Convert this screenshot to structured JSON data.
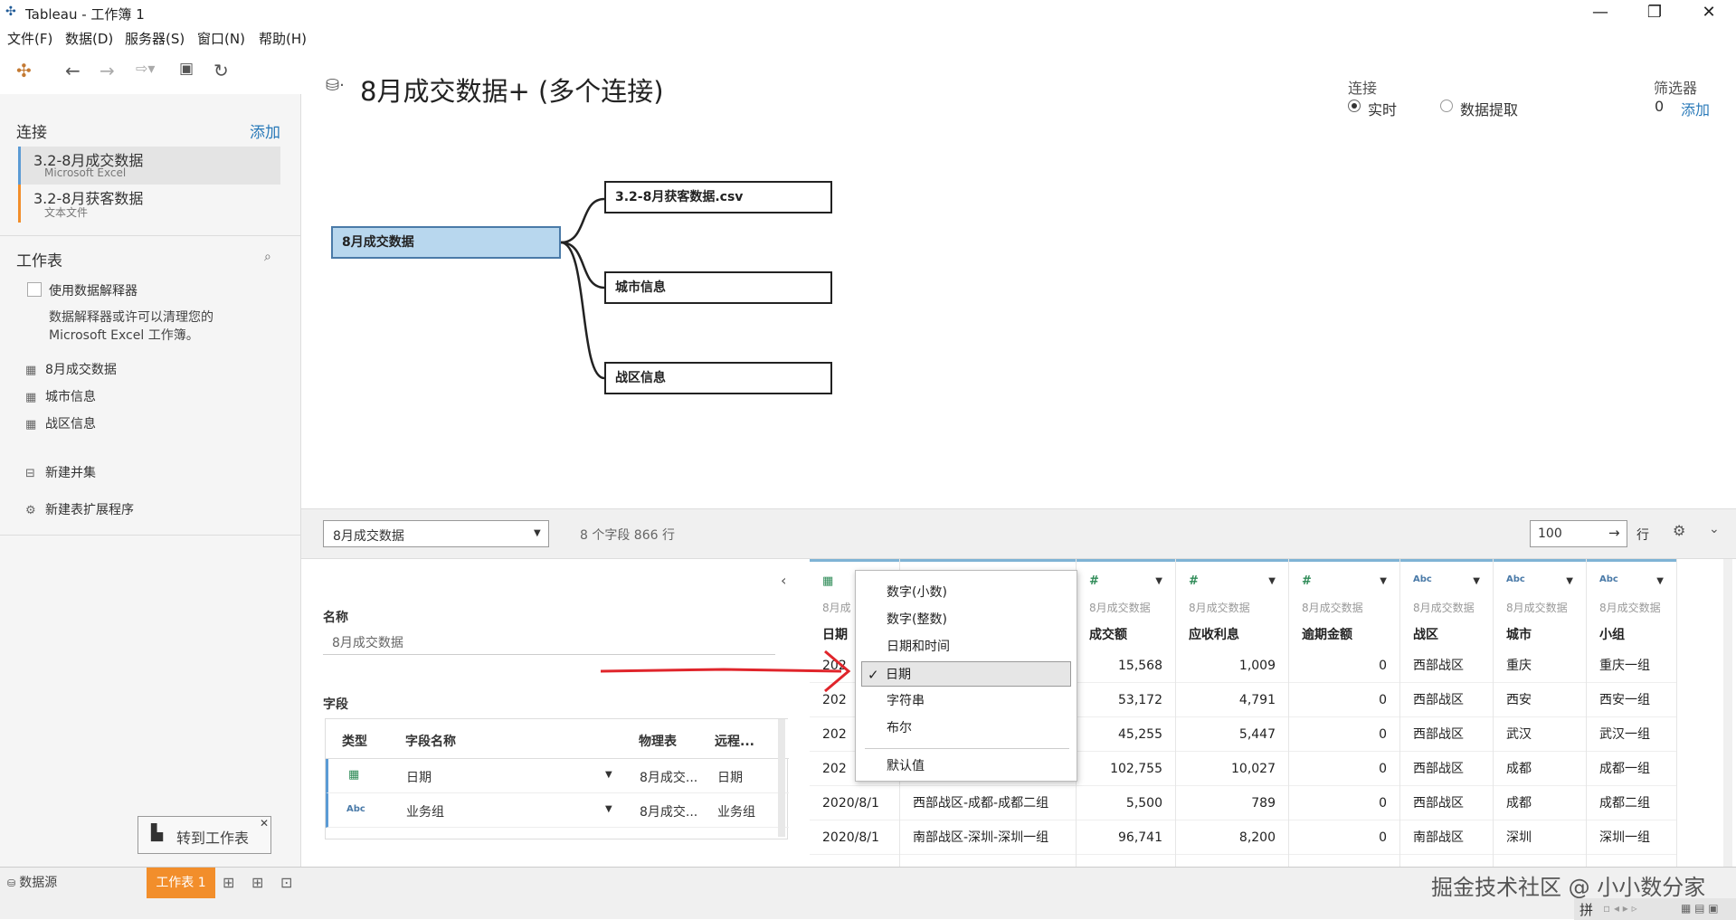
{
  "window": {
    "title": "Tableau - 工作簿 1"
  },
  "menu": [
    "文件(F)",
    "数据(D)",
    "服务器(S)",
    "窗口(N)",
    "帮助(H)"
  ],
  "left": {
    "connections_label": "连接",
    "add_label": "添加",
    "connections": [
      {
        "name": "3.2-8月成交数据",
        "type": "Microsoft Excel"
      },
      {
        "name": "3.2-8月获客数据",
        "type": "文本文件"
      }
    ],
    "sheets_label": "工作表",
    "interpreter_label": "使用数据解释器",
    "interpreter_desc_1": "数据解释器或许可以清理您的",
    "interpreter_desc_2": "Microsoft Excel 工作簿。",
    "sheets": [
      "8月成交数据",
      "城市信息",
      "战区信息"
    ],
    "new_union": "新建并集",
    "new_extension": "新建表扩展程序"
  },
  "canvas": {
    "title": "8月成交数据+ (多个连接)",
    "connection_label": "连接",
    "live_label": "实时",
    "extract_label": "数据提取",
    "filter_label": "筛选器",
    "filter_count": "0",
    "filter_add": "添加",
    "main_table": "8月成交数据",
    "joined_tables": [
      "3.2-8月获客数据.csv",
      "城市信息",
      "战区信息"
    ]
  },
  "datagrid_bar": {
    "table_select": "8月成交数据",
    "info": "8 个字段 866 行",
    "rows_value": "100",
    "rows_label": "行"
  },
  "metadata": {
    "name_label": "名称",
    "name_value": "8月成交数据",
    "fields_label": "字段",
    "headers": [
      "类型",
      "字段名称",
      "物理表",
      "远程..."
    ],
    "rows": [
      {
        "type_icon": "calendar-icon",
        "name": "日期",
        "table": "8月成交...",
        "remote": "日期"
      },
      {
        "type_icon": "abc-icon",
        "name": "业务组",
        "table": "8月成交...",
        "remote": "业务组"
      }
    ]
  },
  "grid": {
    "columns": [
      {
        "src": "8月成",
        "name": "日期",
        "type": "date",
        "cells": [
          "202",
          "202",
          "202",
          "202",
          "2020/8/1",
          "2020/8/1"
        ]
      },
      {
        "src": "",
        "name": "",
        "type": "abc",
        "cells": [
          "",
          "",
          "",
          "",
          "西部战区-成都-成都二组",
          "南部战区-深圳-深圳一组"
        ]
      },
      {
        "src": "8月成交数据",
        "name": "成交额",
        "type": "num",
        "cells": [
          "15,568",
          "53,172",
          "45,255",
          "102,755",
          "5,500",
          "96,741"
        ]
      },
      {
        "src": "8月成交数据",
        "name": "应收利息",
        "type": "num",
        "cells": [
          "1,009",
          "4,791",
          "5,447",
          "10,027",
          "789",
          "8,200"
        ]
      },
      {
        "src": "8月成交数据",
        "name": "逾期金额",
        "type": "num",
        "cells": [
          "0",
          "0",
          "0",
          "0",
          "0",
          "0"
        ]
      },
      {
        "src": "8月成交数据",
        "name": "战区",
        "type": "abc",
        "cells": [
          "西部战区",
          "西部战区",
          "西部战区",
          "西部战区",
          "西部战区",
          "南部战区"
        ]
      },
      {
        "src": "8月成交数据",
        "name": "城市",
        "type": "abc",
        "cells": [
          "重庆",
          "西安",
          "武汉",
          "成都",
          "成都",
          "深圳"
        ]
      },
      {
        "src": "8月成交数据",
        "name": "小组",
        "type": "abc",
        "cells": [
          "重庆一组",
          "西安一组",
          "武汉一组",
          "成都一组",
          "成都二组",
          "深圳一组"
        ]
      }
    ],
    "type_icons": {
      "num": "#",
      "abc": "Abc",
      "date": "▦"
    }
  },
  "dropdown": {
    "items": [
      "数字(小数)",
      "数字(整数)",
      "日期和时间",
      "日期",
      "字符串",
      "布尔",
      "默认值"
    ],
    "selected": "日期",
    "check": "✓"
  },
  "footer": {
    "datasource_tab": "数据源",
    "sheet_tab": "工作表 1",
    "goto_sheet": "转到工作表",
    "watermark": "掘金技术社区 @ 小小数分家"
  },
  "colors": {
    "accent_orange": "#f28e2b",
    "node_selected": "#b8d7ee",
    "arrow_red": "#e0252b",
    "link_blue": "#2a7ab9"
  }
}
